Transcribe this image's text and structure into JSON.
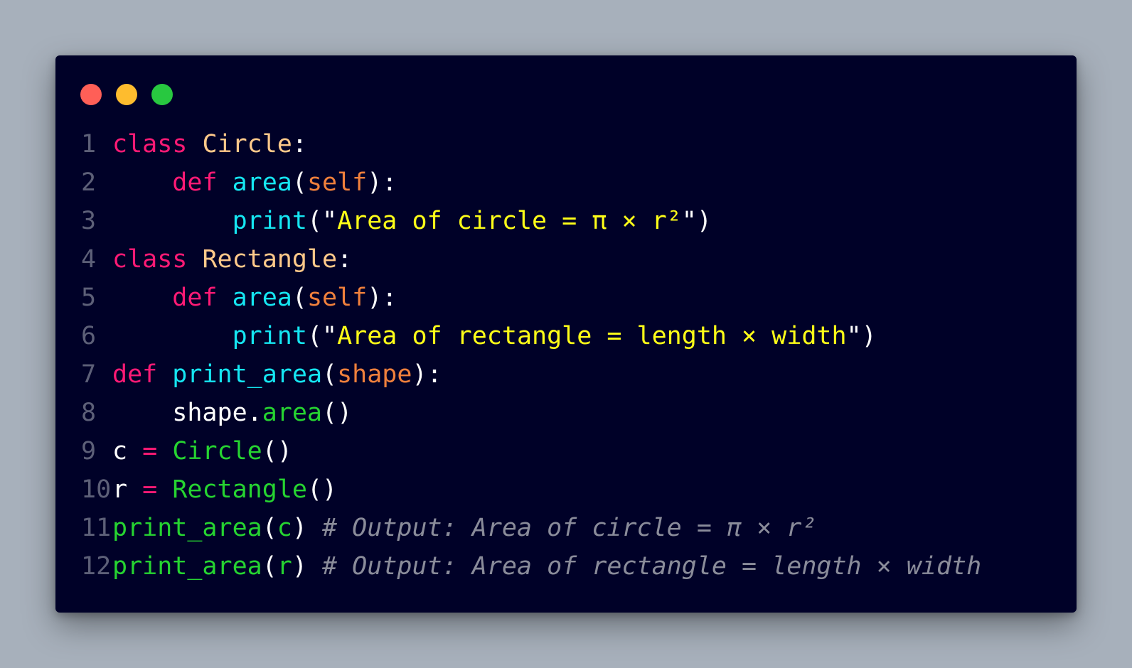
{
  "window": {
    "traffic_lights": [
      {
        "name": "close",
        "color": "#ff5f57"
      },
      {
        "name": "minimize",
        "color": "#febc2e"
      },
      {
        "name": "maximize",
        "color": "#28c840"
      }
    ]
  },
  "code": {
    "language": "python",
    "lines": [
      {
        "number": "1",
        "tokens": [
          {
            "t": "class",
            "k": "keyword"
          },
          {
            "t": " ",
            "k": "plain"
          },
          {
            "t": "Circle",
            "k": "classname"
          },
          {
            "t": ":",
            "k": "plain"
          }
        ]
      },
      {
        "number": "2",
        "tokens": [
          {
            "t": "    ",
            "k": "plain"
          },
          {
            "t": "def",
            "k": "keyword"
          },
          {
            "t": " ",
            "k": "plain"
          },
          {
            "t": "area",
            "k": "func"
          },
          {
            "t": "(",
            "k": "plain"
          },
          {
            "t": "self",
            "k": "param"
          },
          {
            "t": "):",
            "k": "plain"
          }
        ]
      },
      {
        "number": "3",
        "tokens": [
          {
            "t": "        ",
            "k": "plain"
          },
          {
            "t": "print",
            "k": "func"
          },
          {
            "t": "(\"",
            "k": "plain"
          },
          {
            "t": "Area of circle = π × r²",
            "k": "string"
          },
          {
            "t": "\")",
            "k": "plain"
          }
        ]
      },
      {
        "number": "4",
        "tokens": [
          {
            "t": "class",
            "k": "keyword"
          },
          {
            "t": " ",
            "k": "plain"
          },
          {
            "t": "Rectangle",
            "k": "classname"
          },
          {
            "t": ":",
            "k": "plain"
          }
        ]
      },
      {
        "number": "5",
        "tokens": [
          {
            "t": "    ",
            "k": "plain"
          },
          {
            "t": "def",
            "k": "keyword"
          },
          {
            "t": " ",
            "k": "plain"
          },
          {
            "t": "area",
            "k": "func"
          },
          {
            "t": "(",
            "k": "plain"
          },
          {
            "t": "self",
            "k": "param"
          },
          {
            "t": "):",
            "k": "plain"
          }
        ]
      },
      {
        "number": "6",
        "tokens": [
          {
            "t": "        ",
            "k": "plain"
          },
          {
            "t": "print",
            "k": "func"
          },
          {
            "t": "(\"",
            "k": "plain"
          },
          {
            "t": "Area of rectangle = length × width",
            "k": "string"
          },
          {
            "t": "\")",
            "k": "plain"
          }
        ]
      },
      {
        "number": "7",
        "tokens": [
          {
            "t": "def",
            "k": "keyword"
          },
          {
            "t": " ",
            "k": "plain"
          },
          {
            "t": "print_area",
            "k": "func"
          },
          {
            "t": "(",
            "k": "plain"
          },
          {
            "t": "shape",
            "k": "param"
          },
          {
            "t": "):",
            "k": "plain"
          }
        ]
      },
      {
        "number": "8",
        "tokens": [
          {
            "t": "    shape.",
            "k": "plain"
          },
          {
            "t": "area",
            "k": "call"
          },
          {
            "t": "()",
            "k": "plain"
          }
        ]
      },
      {
        "number": "9",
        "tokens": [
          {
            "t": "c ",
            "k": "plain"
          },
          {
            "t": "=",
            "k": "op"
          },
          {
            "t": " ",
            "k": "plain"
          },
          {
            "t": "Circle",
            "k": "call"
          },
          {
            "t": "()",
            "k": "plain"
          }
        ]
      },
      {
        "number": "10",
        "tokens": [
          {
            "t": "r ",
            "k": "plain"
          },
          {
            "t": "=",
            "k": "op"
          },
          {
            "t": " ",
            "k": "plain"
          },
          {
            "t": "Rectangle",
            "k": "call"
          },
          {
            "t": "()",
            "k": "plain"
          }
        ]
      },
      {
        "number": "11",
        "tokens": [
          {
            "t": "print_area",
            "k": "call"
          },
          {
            "t": "(",
            "k": "plain"
          },
          {
            "t": "c",
            "k": "call"
          },
          {
            "t": ") ",
            "k": "plain"
          },
          {
            "t": "# Output: Area of circle = π × r²",
            "k": "comment"
          }
        ]
      },
      {
        "number": "12",
        "tokens": [
          {
            "t": "print_area",
            "k": "call"
          },
          {
            "t": "(",
            "k": "plain"
          },
          {
            "t": "r",
            "k": "call"
          },
          {
            "t": ") ",
            "k": "plain"
          },
          {
            "t": "# Output: Area of rectangle = length × width",
            "k": "comment"
          }
        ]
      }
    ]
  }
}
